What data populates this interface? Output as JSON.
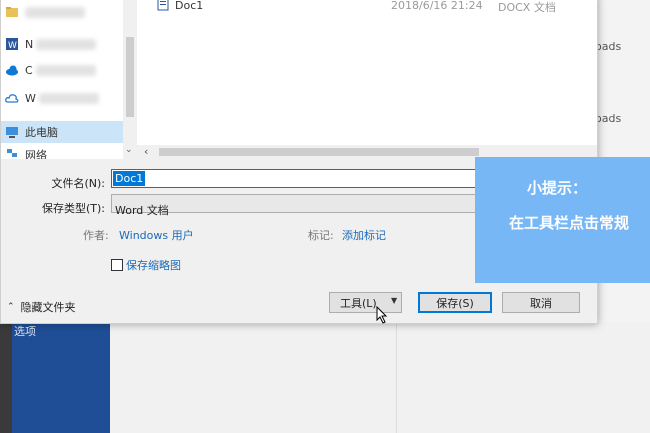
{
  "background": {
    "sidebar_label": "选项",
    "recent_items": [
      "nloads",
      "nloads"
    ]
  },
  "nav": {
    "items": [
      {
        "label": "",
        "icon": "folder-icon"
      },
      {
        "label": "N",
        "icon": "word-doc-icon"
      },
      {
        "label": "C",
        "icon": "onedrive-icon"
      },
      {
        "label": "W",
        "icon": "cloud-icon"
      },
      {
        "label": "此电脑",
        "icon": "computer-icon"
      },
      {
        "label": "网络",
        "icon": "network-icon"
      }
    ]
  },
  "file_list": {
    "rows": [
      {
        "name": "Doc1",
        "date": "2018/6/16 21:24",
        "type": "DOCX 文档",
        "icon": "word-doc-icon"
      }
    ]
  },
  "form": {
    "filename_label": "文件名(N):",
    "filename_value": "Doc1",
    "type_label": "保存类型(T):",
    "type_value": "Word 文档",
    "author_label": "作者:",
    "author_value": "Windows 用户",
    "tags_label": "标记:",
    "tags_value": "添加标记",
    "thumbnail_label": "保存缩略图",
    "thumbnail_checked": false
  },
  "footer": {
    "hide_folders": "隐藏文件夹",
    "tools": "工具(L)",
    "save": "保存(S)",
    "cancel": "取消"
  },
  "tip": {
    "title": "小提示：",
    "body": "在工具栏点击常规"
  },
  "colors": {
    "accent": "#0078d7",
    "tip_bg": "#78b7f5",
    "word_sidebar": "#1f4e96",
    "link": "#1c6ab8"
  }
}
